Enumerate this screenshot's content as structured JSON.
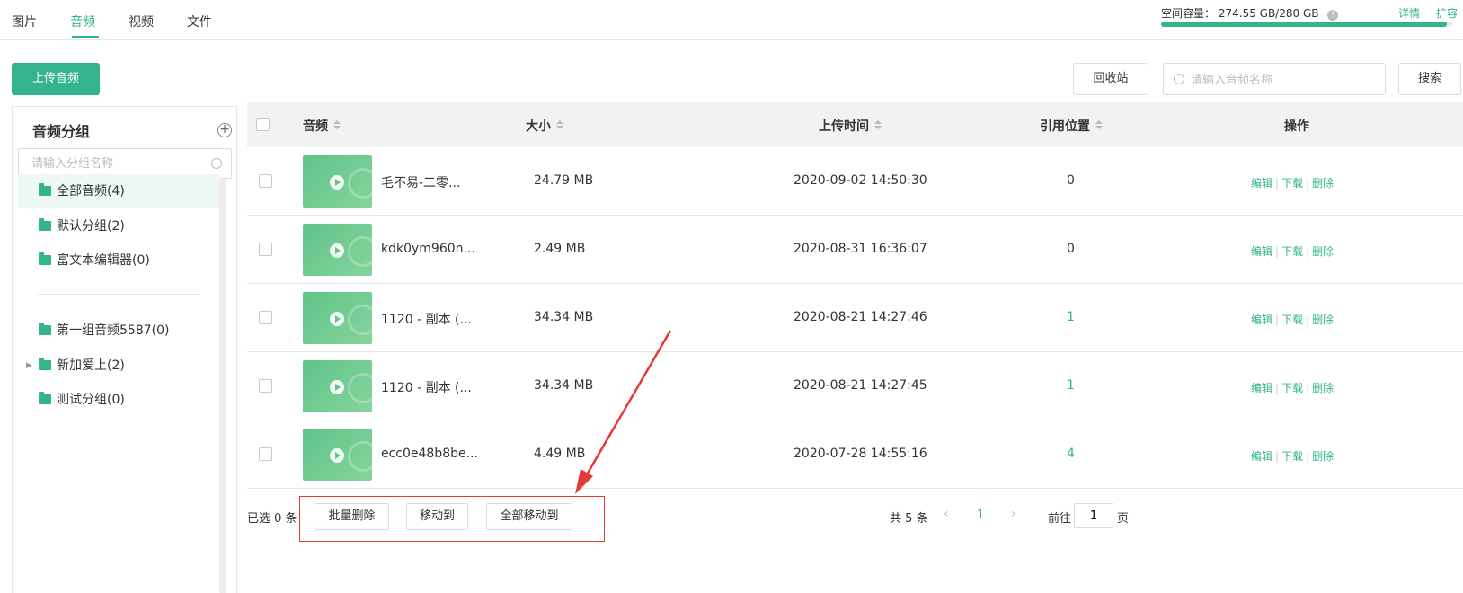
{
  "tabs": [
    {
      "label": "图片",
      "active": false
    },
    {
      "label": "音频",
      "active": true
    },
    {
      "label": "视频",
      "active": false
    },
    {
      "label": "文件",
      "active": false
    }
  ],
  "capacity": {
    "label": "空间容量：",
    "value": "274.55 GB/280 GB",
    "used_fraction": 0.981,
    "detail": "详情",
    "expand": "扩容"
  },
  "toolbar": {
    "upload": "上传音频",
    "recycle": "回收站",
    "search_placeholder": "请输入音频名称",
    "search": "搜索"
  },
  "sidebar": {
    "title": "音频分组",
    "search_placeholder": "请输入分组名称",
    "groups": [
      {
        "label": "全部音频(4)",
        "active": true
      },
      {
        "label": "默认分组(2)"
      },
      {
        "label": "富文本编辑器(0)"
      }
    ],
    "custom_groups": [
      {
        "label": "第一组音频5587(0)"
      },
      {
        "label": "新加爱上(2)",
        "expandable": true
      },
      {
        "label": "测试分组(0)"
      }
    ]
  },
  "table": {
    "headers": {
      "audio": "音频",
      "size": "大小",
      "time": "上传时间",
      "ref": "引用位置",
      "ops": "操作"
    },
    "ops_labels": {
      "edit": "编辑",
      "download": "下载",
      "delete": "删除"
    },
    "rows": [
      {
        "name": "毛不易-二零...",
        "size": "24.79 MB",
        "time": "2020-09-02 14:50:30",
        "ref": "0"
      },
      {
        "name": "kdk0ym960n...",
        "size": "2.49 MB",
        "time": "2020-08-31 16:36:07",
        "ref": "0"
      },
      {
        "name": "1120 - 副本 (...",
        "size": "34.34 MB",
        "time": "2020-08-21 14:27:46",
        "ref": "1"
      },
      {
        "name": "1120 - 副本 (...",
        "size": "34.34 MB",
        "time": "2020-08-21 14:27:45",
        "ref": "1"
      },
      {
        "name": "ecc0e48b8be...",
        "size": "4.49 MB",
        "time": "2020-07-28 14:55:16",
        "ref": "4"
      }
    ]
  },
  "footer": {
    "selected": "已选 0 条",
    "batch_delete": "批量删除",
    "move_to": "移动到",
    "move_all": "全部移动到",
    "total": "共 5 条",
    "page": "1",
    "goto": "前往",
    "goto_value": "1",
    "page_unit": "页"
  },
  "colors": {
    "accent": "#33b38e",
    "annotation": "#e53935"
  }
}
